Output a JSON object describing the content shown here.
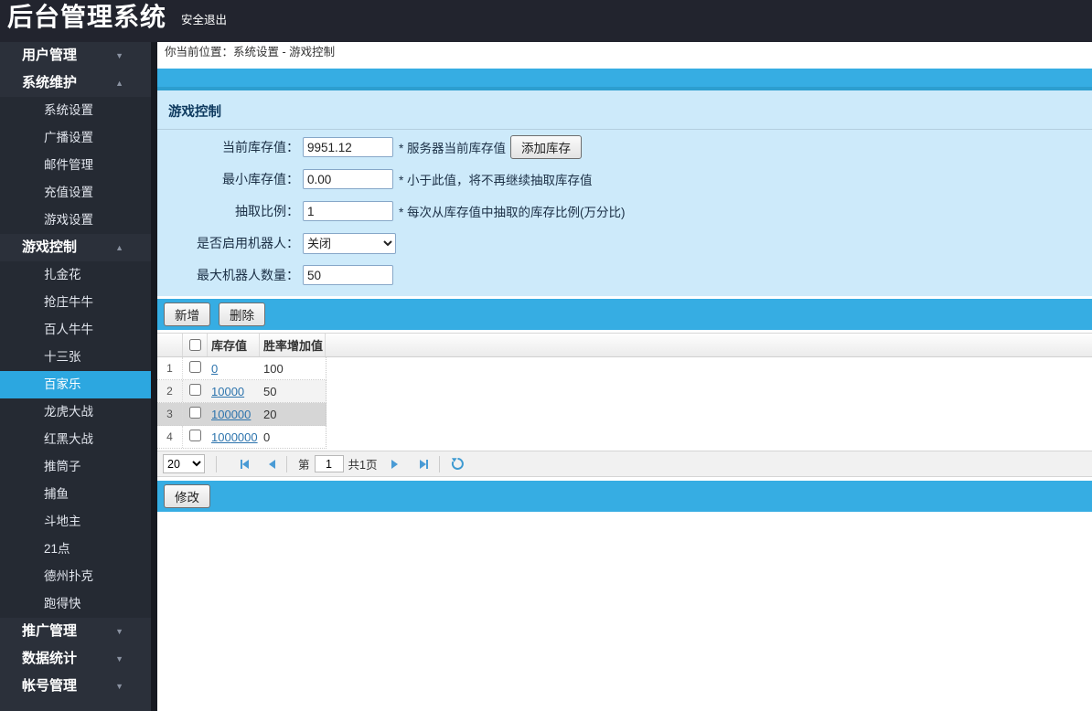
{
  "colors": {
    "topbar_dark": "#22242e",
    "sidebar_dark": "#2b303a",
    "accent_blue": "#36ade3",
    "active_item_blue": "#2ca7e0",
    "panel_light_blue": "#cdeafa",
    "link_blue": "#2d74ad",
    "pager_arrow_blue": "#4a9bd5"
  },
  "icons": {
    "chevron_down": "▼",
    "chevron_up": "▲",
    "refresh": "refresh-circle-arrow"
  },
  "topbar": {
    "title": "后台管理系统",
    "logout_label": "安全退出"
  },
  "breadcrumb": "你当前位置：系统设置 - 游戏控制",
  "sidebar": {
    "sections": [
      {
        "label": "用户管理",
        "expanded": false
      },
      {
        "label": "系统维护",
        "expanded": true,
        "items": [
          "系统设置",
          "广播设置",
          "邮件管理",
          "充值设置",
          "游戏设置"
        ]
      },
      {
        "label": "游戏控制",
        "expanded": true,
        "active_item": "百家乐",
        "items": [
          "扎金花",
          "抢庄牛牛",
          "百人牛牛",
          "十三张",
          "百家乐",
          "龙虎大战",
          "红黑大战",
          "推筒子",
          "捕鱼",
          "斗地主",
          "21点",
          "德州扑克",
          "跑得快"
        ]
      },
      {
        "label": "推广管理",
        "expanded": false
      },
      {
        "label": "数据统计",
        "expanded": false
      },
      {
        "label": "帐号管理",
        "expanded": false
      }
    ]
  },
  "panel": {
    "title": "游戏控制",
    "fields": [
      {
        "label": "当前库存值：",
        "value": "9951.12",
        "note": "* 服务器当前库存值",
        "button": "添加库存"
      },
      {
        "label": "最小库存值：",
        "value": "0.00",
        "note": "* 小于此值，将不再继续抽取库存值"
      },
      {
        "label": "抽取比例：",
        "value": "1",
        "note": "* 每次从库存值中抽取的库存比例(万分比)"
      },
      {
        "label": "是否启用机器人：",
        "select_value": "关闭"
      },
      {
        "label": "最大机器人数量：",
        "value": "50"
      }
    ]
  },
  "toolbar": {
    "add_label": "新增",
    "delete_label": "删除"
  },
  "grid": {
    "columns": [
      "库存值",
      "胜率增加值"
    ],
    "rows": [
      {
        "index": "1",
        "stock_value": "0",
        "win_rate_add": "100"
      },
      {
        "index": "2",
        "stock_value": "10000",
        "win_rate_add": "50"
      },
      {
        "index": "3",
        "stock_value": "100000",
        "win_rate_add": "20"
      },
      {
        "index": "4",
        "stock_value": "1000000",
        "win_rate_add": "0"
      }
    ]
  },
  "pager": {
    "page_size": "20",
    "prefix_label": "第",
    "current_page": "1",
    "total_label": "共1页"
  },
  "footer": {
    "modify_label": "修改"
  }
}
